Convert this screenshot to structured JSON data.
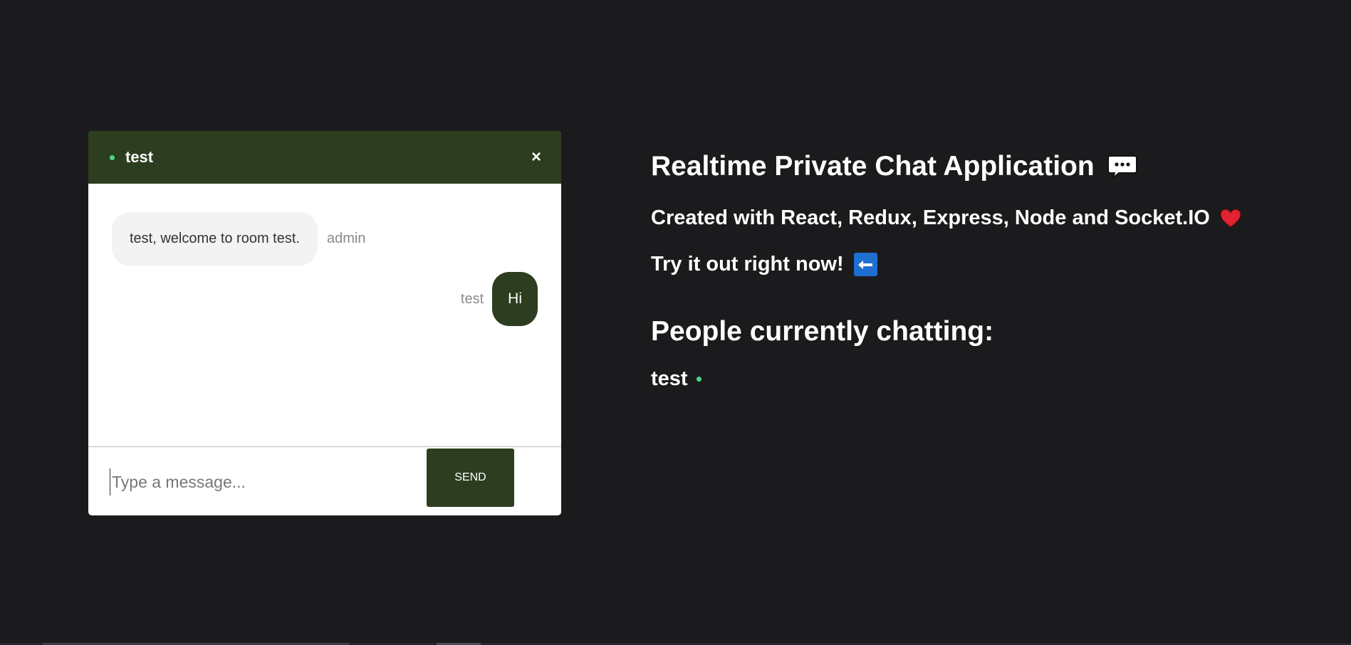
{
  "chat": {
    "room_name": "test",
    "close_label": "×",
    "messages": [
      {
        "text": "test, welcome to room test.",
        "sender": "admin"
      },
      {
        "text": "Hi",
        "sender": "test"
      }
    ],
    "input_placeholder": "Type a message...",
    "input_value": "",
    "send_label": "SEND"
  },
  "info": {
    "title": "Realtime Private Chat Application",
    "subtitle": "Created with React, Redux, Express, Node and Socket.IO",
    "cta": "Try it out right now!",
    "people_heading": "People currently chatting:",
    "people": [
      "test"
    ]
  },
  "colors": {
    "background": "#1b1b1e",
    "accent": "#2c3e1f",
    "online": "#4cd68a"
  },
  "icons": {
    "title": "speech-bubble-icon",
    "subtitle": "heart-icon",
    "cta": "left-arrow-icon"
  }
}
